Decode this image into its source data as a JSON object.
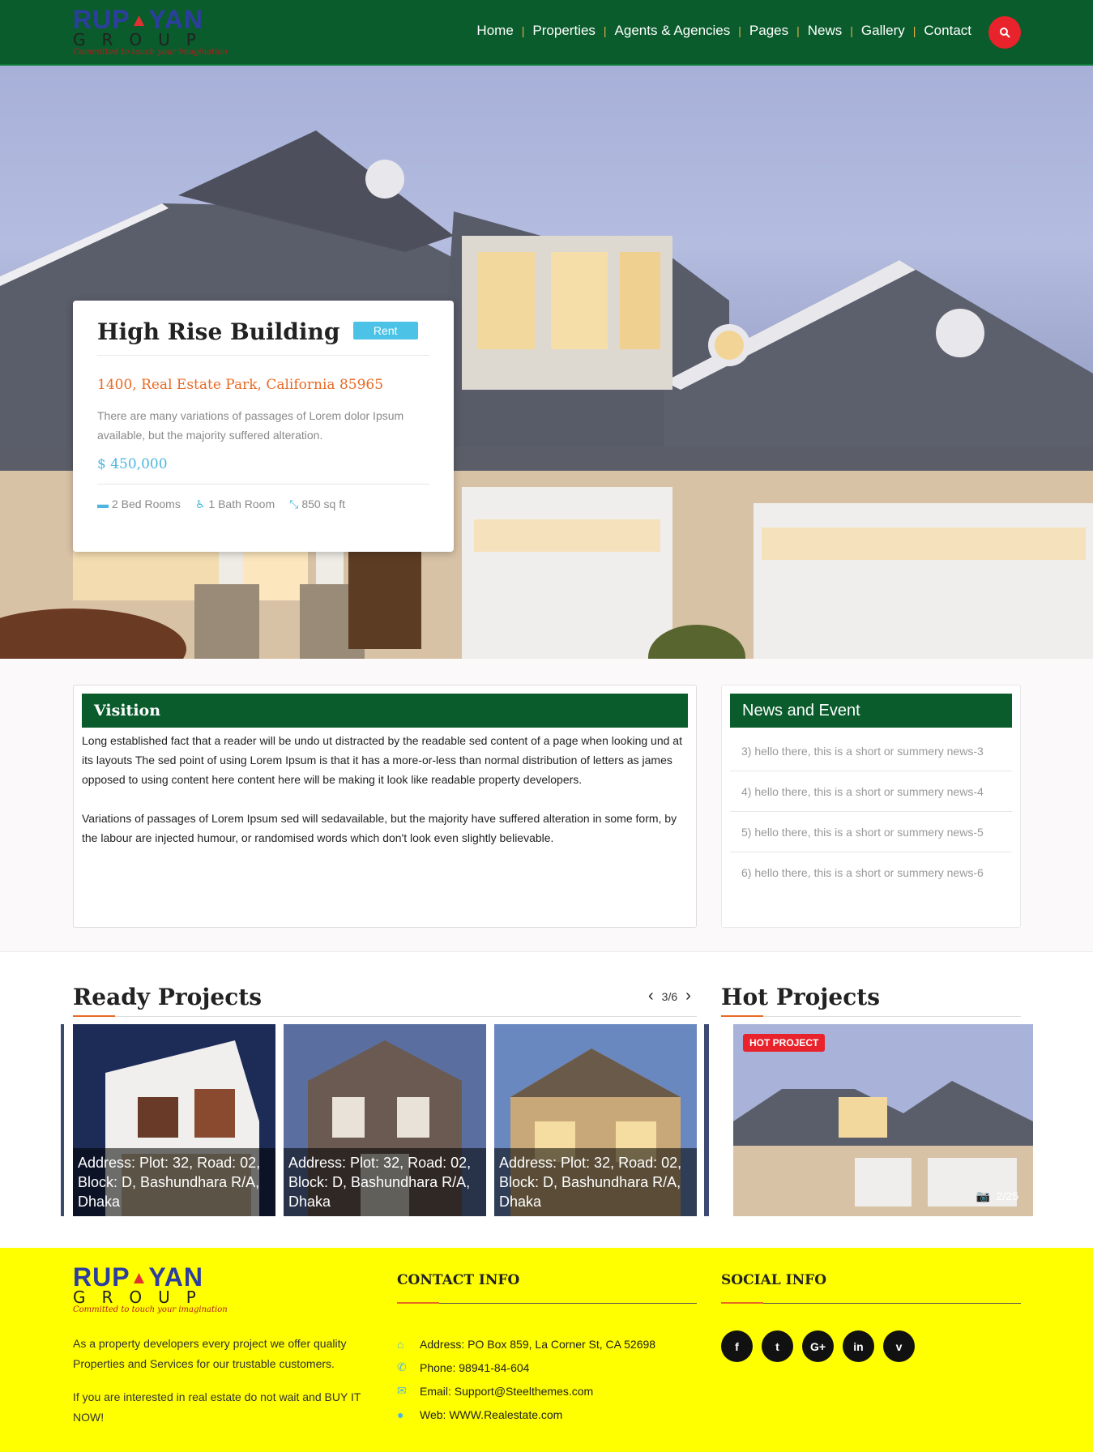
{
  "header": {
    "logo": {
      "line1_a": "RUP",
      "line1_b": "YAN",
      "line2": "GROUP",
      "tagline": "Committed to touch your imagination"
    },
    "nav": [
      "Home",
      "Properties",
      "Agents & Agencies",
      "Pages",
      "News",
      "Gallery",
      "Contact"
    ],
    "search_icon": "search-icon",
    "accent_color": "#e8232b",
    "bar_color": "#0a5c2c"
  },
  "hero": {
    "title": "High Rise Building",
    "badge": "Rent",
    "address": "1400, Real Estate Park, California 85965",
    "description": "There are many variations of passages of Lorem dolor Ipsum available, but the majority suffered alteration.",
    "price": "$ 450,000",
    "features": [
      {
        "icon": "bed-icon",
        "label": "2 Bed Rooms"
      },
      {
        "icon": "accessible-icon",
        "label": "1 Bath Room"
      },
      {
        "icon": "expand-icon",
        "label": "850 sq ft"
      }
    ]
  },
  "vision": {
    "title": "Visition",
    "p1": "Long established fact that a reader will be undo ut distracted by the readable sed content of a page when looking und at its layouts The sed point of using Lorem Ipsum is that it has a more-or-less than normal distribution of letters as james opposed to using content here content here will be making it look like readable property developers.",
    "p2": "Variations of passages of Lorem Ipsum sed will sedavailable, but the majority have suffered alteration in some form, by the labour are injected humour, or randomised words which don't look even slightly believable."
  },
  "news": {
    "title": "News and Event",
    "items": [
      "3) hello there, this is a short or summery news-3",
      "4) hello there, this is a short or summery news-4",
      "5) hello there, this is a short or summery news-5",
      "6) hello there, this is a short or summery news-6"
    ]
  },
  "ready_projects": {
    "title": "Ready Projects",
    "pager": "3/6",
    "items": [
      "Address: Plot: 32, Road: 02, Block: D, Bashundhara R/A, Dhaka",
      "Address: Plot: 32, Road: 02, Block: D, Bashundhara R/A, Dhaka",
      "Address: Plot: 32, Road: 02, Block: D, Bashundhara R/A, Dhaka"
    ]
  },
  "hot_projects": {
    "title": "Hot Projects",
    "badge": "HOT PROJECT",
    "count": "2/25"
  },
  "footer": {
    "about_p1": "As a property developers every project we offer quality Properties and Services for our trustable customers.",
    "about_p2": "If you are interested in real estate do not wait and BUY IT NOW!",
    "contact_title": "CONTACT INFO",
    "contacts": [
      {
        "icon": "home-icon",
        "text": "Address: PO Box 859, La Corner St, CA 52698"
      },
      {
        "icon": "phone-icon",
        "text": "Phone: 98941-84-604"
      },
      {
        "icon": "mail-icon",
        "text": "Email: Support@Steelthemes.com"
      },
      {
        "icon": "globe-icon",
        "text": "Web: WWW.Realestate.com"
      }
    ],
    "social_title": "SOCIAL INFO",
    "socials": [
      {
        "icon": "facebook-icon",
        "glyph": "f"
      },
      {
        "icon": "twitter-icon",
        "glyph": "t"
      },
      {
        "icon": "google-plus-icon",
        "glyph": "G+"
      },
      {
        "icon": "linkedin-icon",
        "glyph": "in"
      },
      {
        "icon": "vimeo-icon",
        "glyph": "v"
      }
    ]
  }
}
